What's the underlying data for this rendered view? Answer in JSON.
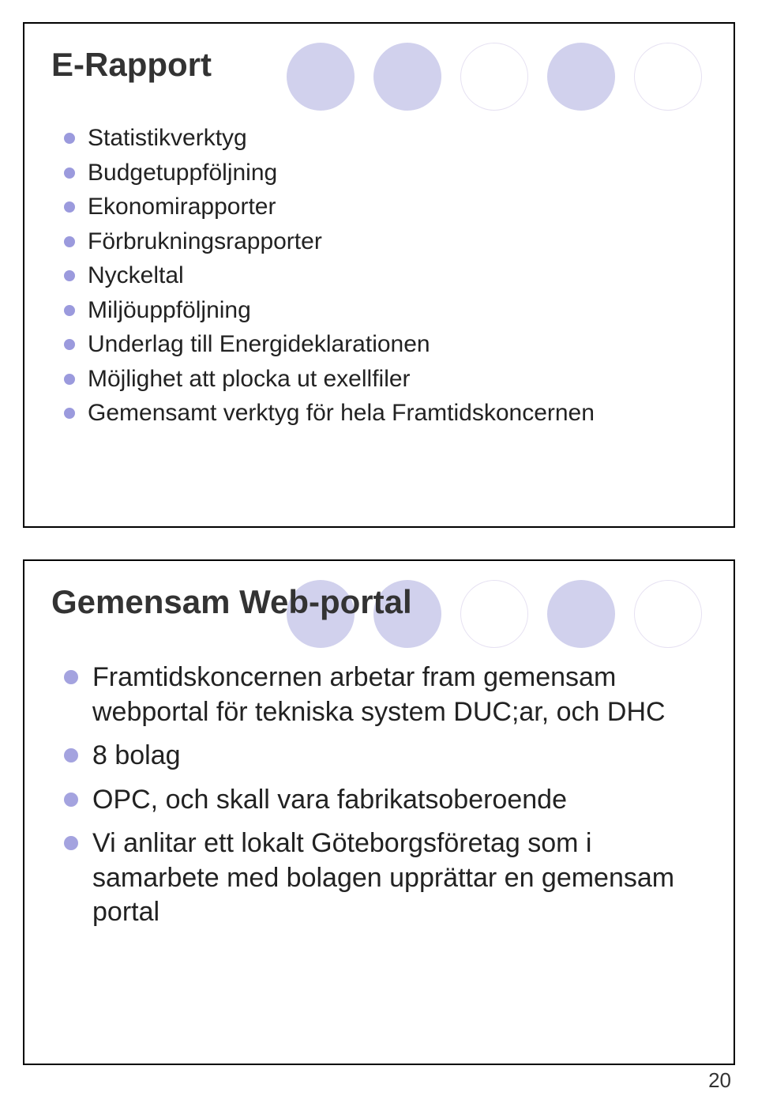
{
  "slide1": {
    "title": "E-Rapport",
    "items": [
      "Statistikverktyg",
      "Budgetuppföljning",
      "Ekonomirapporter",
      "Förbrukningsrapporter",
      "Nyckeltal",
      "Miljöuppföljning",
      "Underlag till Energideklarationen",
      "Möjlighet att plocka ut exellfiler",
      "Gemensamt verktyg för hela Framtidskoncernen"
    ]
  },
  "slide2": {
    "title": "Gemensam Web-portal",
    "items": [
      "Framtidskoncernen arbetar fram gemensam webportal för tekniska system DUC;ar, och DHC",
      "8 bolag",
      "OPC, och skall vara fabrikatsoberoende",
      "Vi anlitar ett lokalt Göteborgsföretag som i samarbete med bolagen upprättar en gemensam portal"
    ]
  },
  "pageNumber": "20"
}
